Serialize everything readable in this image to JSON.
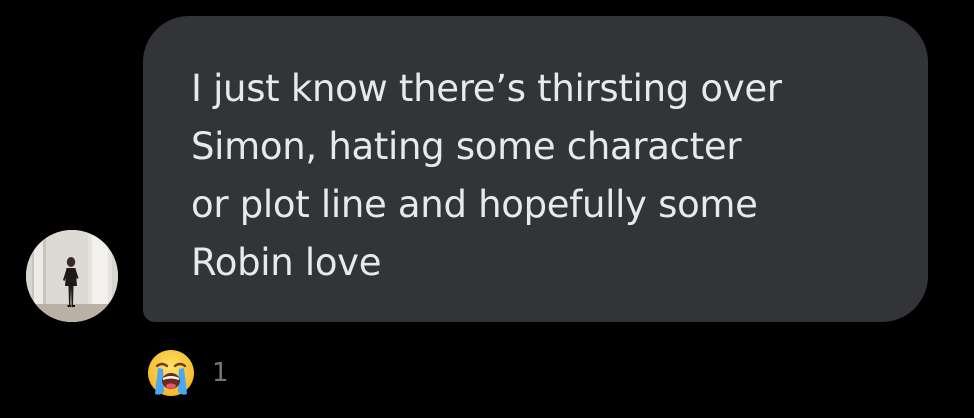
{
  "message": {
    "text": "I just know there’s thirsting over\nSimon, hating some character\nor plot line and hopefully some\nRobin love",
    "bubble_color": "#323438",
    "text_color": "#e7e9ea"
  },
  "avatar": {
    "description_icon": "profile-photo"
  },
  "reaction": {
    "emoji_icon": "loudly-crying-face-icon",
    "count": "1"
  },
  "colors": {
    "background": "#000000",
    "muted_text": "#71767b"
  }
}
